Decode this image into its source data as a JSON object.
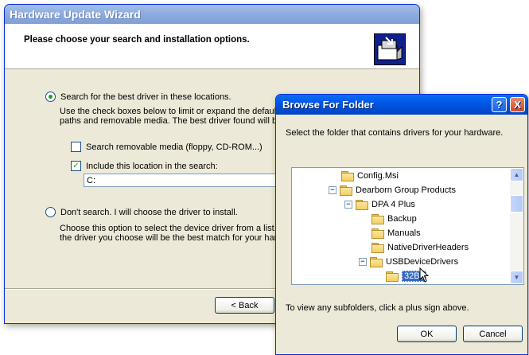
{
  "wizard": {
    "title": "Hardware Update Wizard",
    "heading": "Please choose your search and installation options.",
    "option_search_label": "Search for the best driver in these locations.",
    "option_search_desc_1": "Use the check boxes below to limit or expand the default",
    "option_search_desc_2": "paths and removable media. The best driver found will be",
    "removable_media_label": "Search removable media (floppy, CD-ROM...)",
    "include_location_label": "Include this location in the search:",
    "path_value": "C:",
    "option_manual_label": "Don't search. I will choose the driver to install.",
    "option_manual_desc_1": "Choose this option to select the device driver from a list.  Y",
    "option_manual_desc_2": "the driver you choose will be the best match for your hard",
    "back_button": "< Back"
  },
  "browse": {
    "title": "Browse For Folder",
    "help_glyph": "?",
    "close_glyph": "X",
    "instruction": "Select the folder that contains drivers for your hardware.",
    "tree": [
      {
        "label": "Config.Msi",
        "expander": ""
      },
      {
        "label": "Dearborn Group Products",
        "expander": "−"
      },
      {
        "label": "DPA 4 Plus",
        "expander": "−"
      },
      {
        "label": "Backup",
        "expander": ""
      },
      {
        "label": "Manuals",
        "expander": ""
      },
      {
        "label": "NativeDriverHeaders",
        "expander": ""
      },
      {
        "label": "USBDeviceDrivers",
        "expander": "−"
      },
      {
        "label": "32Bit",
        "expander": ""
      }
    ],
    "hint": "To view any subfolders, click a plus sign above.",
    "ok_button": "OK",
    "cancel_button": "Cancel"
  },
  "icons": {
    "wizard_header": "hardware-install-icon",
    "folder": "folder-icon",
    "radio_selected_color": "#21a121",
    "selection_color": "#316ac5"
  }
}
